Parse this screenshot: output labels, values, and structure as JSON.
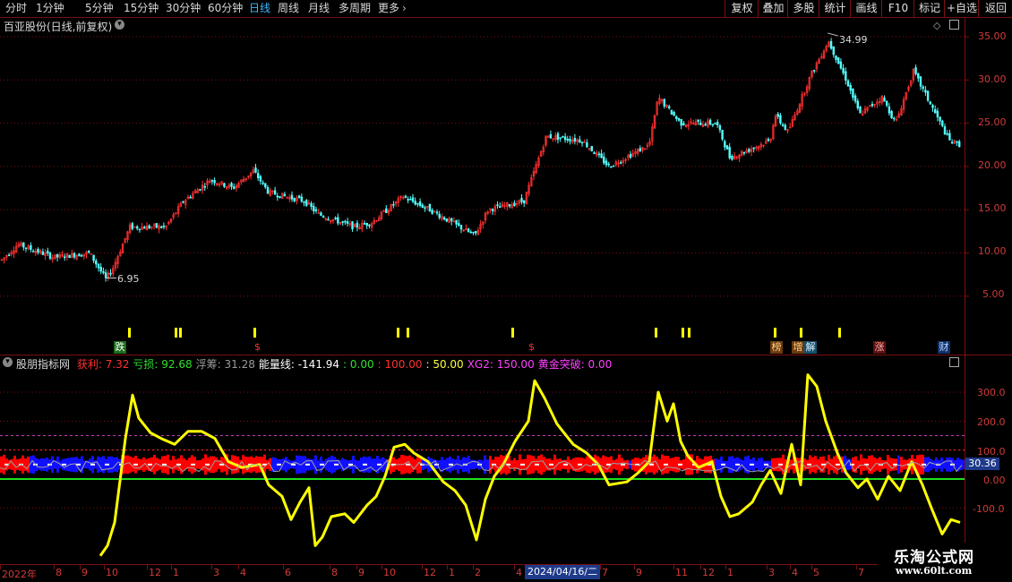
{
  "toolbar": {
    "periods": [
      "分时",
      "1分钟",
      "5分钟",
      "15分钟",
      "30分钟",
      "60分钟",
      "日线",
      "周线",
      "月线",
      "多周期",
      "更多"
    ],
    "active_period": "日线",
    "right_buttons": [
      "复权",
      "叠加",
      "多股",
      "统计",
      "画线",
      "F10",
      "标记",
      "+自选",
      "返回"
    ]
  },
  "main": {
    "stock_title": "百亚股份(日线,前复权)",
    "y_ticks": [
      "35.00",
      "30.00",
      "25.00",
      "20.00",
      "15.00",
      "10.00",
      "5.00"
    ],
    "high_label": "34.99",
    "low_label": "6.95",
    "event_badges": [
      "跌",
      "$",
      "$",
      "榜",
      "增",
      "解",
      "涨",
      "财"
    ]
  },
  "indicator": {
    "name": "股朋指标网",
    "values": [
      {
        "label": "获利",
        "value": "7.32",
        "color": "#ff3030"
      },
      {
        "label": "亏损",
        "value": "92.68",
        "color": "#30e030"
      },
      {
        "label": "浮筹",
        "value": "31.28",
        "color": "#9a9a9a"
      },
      {
        "label": "能量线",
        "value": "-141.94",
        "color": "#ffffff"
      },
      {
        "label": "",
        "value": "0.00",
        "color": "#30e030"
      },
      {
        "label": "",
        "value": "100.00",
        "color": "#ff3030"
      },
      {
        "label": "",
        "value": "50.00",
        "color": "#ffff40"
      },
      {
        "label": "XG2",
        "value": "150.00",
        "color": "#ff40ff"
      },
      {
        "label": "黄金突破",
        "value": "0.00",
        "color": "#ff40ff"
      }
    ],
    "y_ticks": [
      "300.0",
      "200.0",
      "100.0",
      "0.00",
      "-100.0"
    ],
    "current_value": "30.36"
  },
  "date_axis": {
    "labels": [
      "2022年",
      "8",
      "9",
      "10",
      "12",
      "1",
      "3",
      "4",
      "6",
      "8",
      "9",
      "10",
      "12",
      "1",
      "2",
      "4",
      "7",
      "9",
      "11",
      "12",
      "1",
      "3",
      "4",
      "5",
      "7"
    ],
    "cursor_date": "2024/04/16/二"
  },
  "watermark": {
    "title": "乐淘公式网",
    "url": "www.60lt.com"
  },
  "colors": {
    "background": "#000000",
    "grid": "#7a1010",
    "candle_up": "#ff3030",
    "candle_down": "#54ffff",
    "energy_line": "#ffff00",
    "profit_fill": "#ff0000",
    "loss_fill": "#1010ff",
    "zero_line": "#20e020"
  }
}
